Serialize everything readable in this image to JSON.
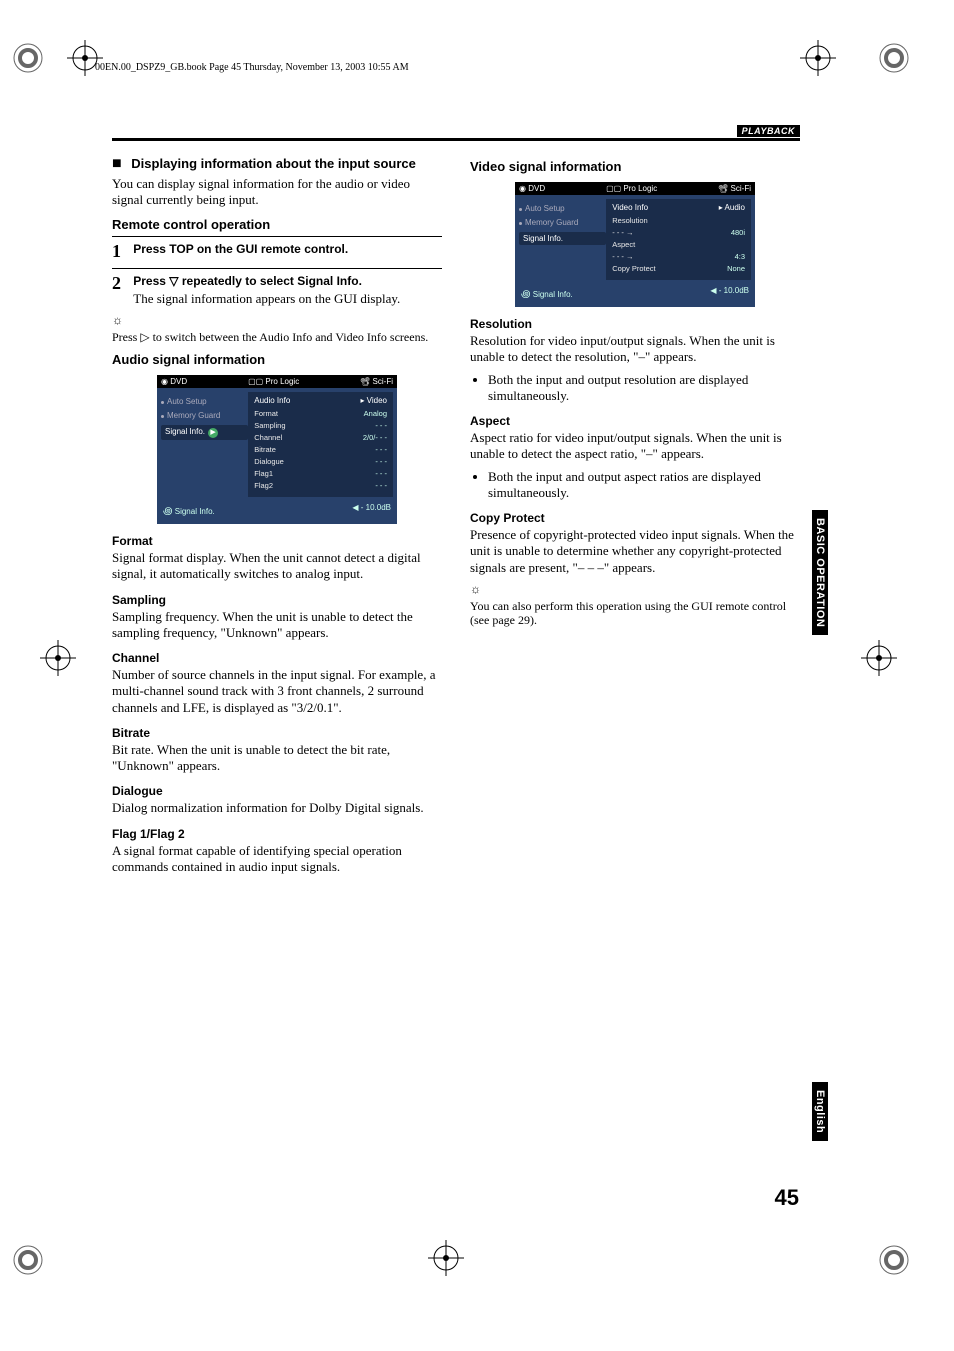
{
  "header_line": "00EN.00_DSPZ9_GB.book  Page 45  Thursday, November 13, 2003  10:55 AM",
  "section_label": "PLAYBACK",
  "page_number": "45",
  "side_tabs": {
    "operation": "BASIC OPERATION",
    "english": "English"
  },
  "left": {
    "title": "Displaying information about the input source",
    "intro": "You can display signal information for the audio or video signal currently being input.",
    "remote_head": "Remote control operation",
    "step1": "Press TOP on the GUI remote control.",
    "step2_a": "Press ",
    "step2_b": " repeatedly to select Signal Info.",
    "step2_desc": "The signal information appears on the GUI display.",
    "hint_symbol": "☼",
    "hint_a": "Press ",
    "hint_b": " to switch between the Audio Info and Video Info screens.",
    "audio_head": "Audio signal information",
    "defs": [
      {
        "t": "Format",
        "b": "Signal format display. When the unit cannot detect a digital signal, it automatically switches to analog input."
      },
      {
        "t": "Sampling",
        "b": "Sampling frequency. When the unit is unable to detect the sampling frequency, \"Unknown\" appears."
      },
      {
        "t": "Channel",
        "b": "Number of source channels in the input signal. For example, a multi-channel sound track with 3 front channels, 2 surround channels and LFE, is displayed as \"3/2/0.1\"."
      },
      {
        "t": "Bitrate",
        "b": "Bit rate. When the unit is unable to detect the bit rate, \"Unknown\" appears."
      },
      {
        "t": "Dialogue",
        "b": "Dialog normalization information for Dolby Digital signals."
      },
      {
        "t": "Flag 1/Flag 2",
        "b": "A signal format capable of identifying special operation commands contained in audio input signals."
      }
    ]
  },
  "right": {
    "video_head": "Video signal information",
    "defs1": {
      "t": "Resolution",
      "b": "Resolution for video input/output signals. When the unit is unable to detect the resolution, \"–\" appears.",
      "li": "Both the input and output resolution are displayed simultaneously."
    },
    "defs2": {
      "t": "Aspect",
      "b": "Aspect ratio for video input/output signals. When the unit is unable to detect the aspect ratio, \"–\" appears.",
      "li": "Both the input and output aspect ratios are displayed simultaneously."
    },
    "defs3": {
      "t": "Copy Protect",
      "b": "Presence of copyright-protected video input signals. When the unit is unable to determine whether any copyright-protected signals are present, \"– – –\" appears."
    },
    "hint_symbol": "☼",
    "hint_text": "You can also perform this operation using the GUI remote control (see page 29)."
  },
  "gui_audio": {
    "hdr_left": "◉ DVD",
    "hdr_mid": "▢▢ Pro Logic",
    "hdr_right": "📽 Sci-Fi",
    "menu": [
      "Auto Setup",
      "Memory Guard",
      "Signal Info."
    ],
    "panel_title": "Audio Info",
    "panel_link": "▸ Video",
    "rows": [
      {
        "l": "Format",
        "v": "Analog"
      },
      {
        "l": "Sampling",
        "v": "- - -"
      },
      {
        "l": "Channel",
        "v": "2/0/- - -"
      },
      {
        "l": "Bitrate",
        "v": "- - -"
      },
      {
        "l": "Dialogue",
        "v": "- - -"
      },
      {
        "l": "Flag1",
        "v": "- - -"
      },
      {
        "l": "Flag2",
        "v": "- - -"
      }
    ],
    "footer_left": "Signal Info.",
    "footer_right": "◀ - 10.0dB"
  },
  "gui_video": {
    "hdr_left": "◉ DVD",
    "hdr_mid": "▢▢ Pro Logic",
    "hdr_right": "📽 Sci-Fi",
    "menu": [
      "Auto Setup",
      "Memory Guard",
      "Signal Info."
    ],
    "panel_title": "Video Info",
    "panel_link": "▸ Audio",
    "rows": [
      {
        "l": "Resolution",
        "v": ""
      },
      {
        "l": "- - -    →",
        "v": "480i"
      },
      {
        "l": "Aspect",
        "v": ""
      },
      {
        "l": "- - -    →",
        "v": "4:3"
      },
      {
        "l": "Copy Protect",
        "v": "None"
      }
    ],
    "footer_left": "Signal Info.",
    "footer_right": "◀ - 10.0dB"
  },
  "symbols": {
    "down": "▽",
    "right": "▷"
  }
}
